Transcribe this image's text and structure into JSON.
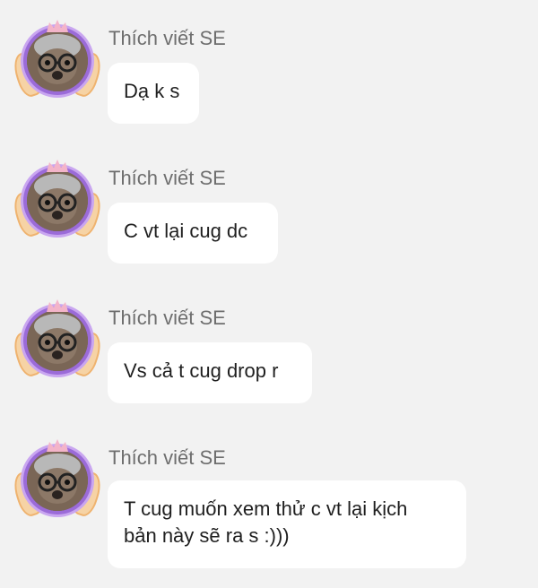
{
  "messages": [
    {
      "sender": "Thích viết SE",
      "text": "Dạ k s"
    },
    {
      "sender": "Thích viết SE",
      "text": "C vt lại cug dc"
    },
    {
      "sender": "Thích viết SE",
      "text": "Vs cả t cug drop r"
    },
    {
      "sender": "Thích viết SE",
      "text": "T cug muốn xem thử c vt lại kịch\nbản này sẽ ra s :)))"
    }
  ],
  "avatar": {
    "icon": "koala-with-glasses-avatar-icon",
    "ring_color": "#9b6bd8",
    "wing_color": "#f6d3a5"
  },
  "colors": {
    "background": "#f2f2f2",
    "bubble": "#ffffff",
    "sender_text": "#6e6e6e",
    "message_text": "#1f1f1f"
  }
}
